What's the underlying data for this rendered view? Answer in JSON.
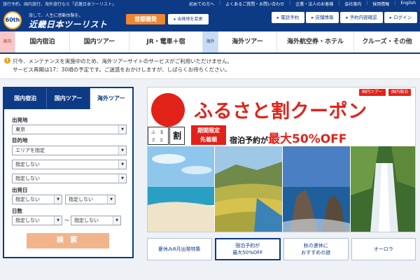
{
  "topbar": {
    "tagline": "旅行予約、国内旅行、海外旅行なら「近畿日本ツーリスト」",
    "links": [
      "初めての方へ",
      "よくあるご質問・お問い合わせ",
      "企業・法人のお客様",
      "会社案内",
      "採用情報",
      "English"
    ]
  },
  "logo": {
    "badge": "60th",
    "sub": "旅して、人生に感動体験を。",
    "name": "近畿日本ツーリスト"
  },
  "header": {
    "region": "首都圏発",
    "region_change": "出発地を変更",
    "links": [
      "電話予約",
      "店舗情報",
      "予約内容確認",
      "ログイン"
    ]
  },
  "nav": {
    "domestic_tag": "国内",
    "domestic_items": [
      "国内宿泊",
      "国内ツアー",
      "JR・電車＋宿"
    ],
    "overseas_tag": "海外",
    "overseas_items": [
      "海外ツアー",
      "海外航空券・ホテル",
      "クルーズ・その他"
    ]
  },
  "notice": {
    "icon": "!",
    "line1": "只今、メンテナンスを実施中のため、海外ツアーサイトのサービスがご利用いただけません。",
    "line2": "サービス再開は17：30頃の予定です。ご迷惑をおかけしますが、しばらくお待ちください。"
  },
  "search": {
    "tabs": [
      "国内宿泊",
      "国内ツアー",
      "海外ツアー"
    ],
    "departure_label": "出発地",
    "departure_value": "東京",
    "destination_label": "目的地",
    "area_value": "エリアを指定",
    "dest_value_2": "指定しない",
    "dest_value_3": "指定しない",
    "date_label": "出発日",
    "date_month": "指定しない",
    "date_day": "指定しない",
    "days_label": "日数",
    "days_from": "指定しない",
    "days_tilde": "〜",
    "days_to": "指定しない",
    "submit": "検 索"
  },
  "banner": {
    "tag1": "国内ツアー",
    "tag2": "国内宿泊",
    "title": "ふるさと割クーポン",
    "furu_1": "ふ",
    "furu_2": "る",
    "furu_3": "さ",
    "furu_4": "と",
    "wari": "割",
    "limited_1": "期間限定",
    "limited_2": "先着順",
    "offer_prefix": "宿泊予約が",
    "offer_highlight": "最大50%OFF",
    "colors": {
      "accent": "#e22219",
      "brand": "#0d3a85",
      "search_button": "#f2b48b",
      "region": "#f0872f"
    }
  },
  "tiles": [
    {
      "line1": "夏休み8月出発特集",
      "line2": ""
    },
    {
      "line1": "宿泊予約が",
      "line2": "最大50%OFF"
    },
    {
      "line1": "秋の連休に",
      "line2": "おすすめの旅"
    },
    {
      "line1": "オーロラ",
      "line2": ""
    }
  ]
}
